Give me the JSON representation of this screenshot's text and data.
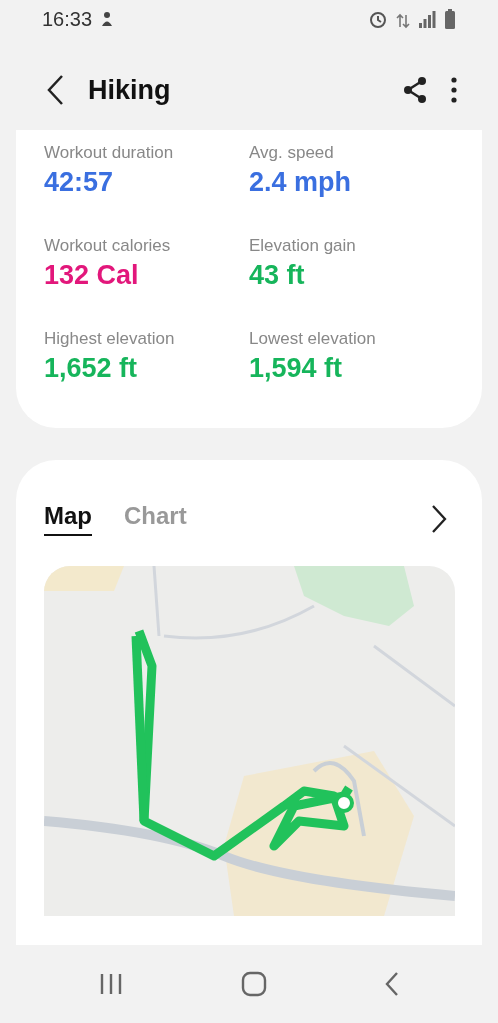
{
  "status_bar": {
    "time": "16:33"
  },
  "header": {
    "title": "Hiking"
  },
  "stats": [
    {
      "label": "Workout duration",
      "value": "42:57",
      "color": "#3a6fe0"
    },
    {
      "label": "Avg. speed",
      "value": "2.4 mph",
      "color": "#3a6fe0"
    },
    {
      "label": "Workout calories",
      "value": "132 Cal",
      "color": "#e2177b"
    },
    {
      "label": "Elevation gain",
      "value": "43 ft",
      "color": "#16b55b"
    },
    {
      "label": "Highest elevation",
      "value": "1,652 ft",
      "color": "#16b55b"
    },
    {
      "label": "Lowest elevation",
      "value": "1,594 ft",
      "color": "#16b55b"
    }
  ],
  "tabs": [
    {
      "label": "Map",
      "selected": true
    },
    {
      "label": "Chart",
      "selected": false
    }
  ]
}
